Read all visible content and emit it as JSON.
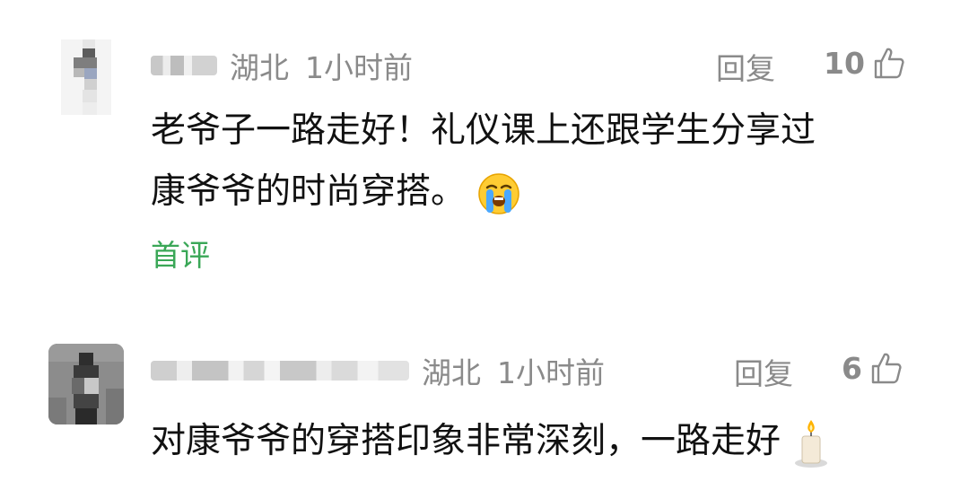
{
  "comments": [
    {
      "location": "湖北",
      "time": "1小时前",
      "reply_label": "回复",
      "likes": "10",
      "text_line1": "老爷子一路走好！礼仪课上还跟学生分享过",
      "text_line2": "康爷爷的时尚穿搭。",
      "emoji": "loudly-crying-face",
      "badge": "首评"
    },
    {
      "location": "湖北",
      "time": "1小时前",
      "reply_label": "回复",
      "likes": "6",
      "text": "对康爷爷的穿搭印象非常深刻，一路走好",
      "emoji": "candle"
    }
  ],
  "colors": {
    "meta_text": "#8a8a8a",
    "body_text": "#111111",
    "badge_green": "#3aa757"
  }
}
